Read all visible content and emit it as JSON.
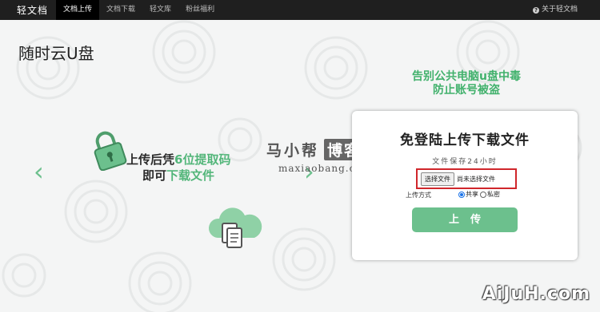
{
  "nav": {
    "brand": "轻文档",
    "items": [
      {
        "label": "文档上传",
        "active": true
      },
      {
        "label": "文档下载",
        "active": false
      },
      {
        "label": "轻文库",
        "active": false
      },
      {
        "label": "粉丝福利",
        "active": false
      }
    ],
    "about": "关于轻文档",
    "about_icon": "info-circle-icon"
  },
  "page": {
    "title": "随时云U盘"
  },
  "slider": {
    "line1_prefix": "上传后凭",
    "line1_highlight": "6位提取码",
    "line2_prefix": "即可",
    "line2_highlight": "下载文件",
    "prev_arrow": "‹",
    "next_arrow": "›",
    "icons": [
      "lock-icon",
      "cloud-document-icon"
    ]
  },
  "warning": {
    "line1": "告别公共电脑u盘中毒",
    "line2": "防止账号被盗"
  },
  "upload": {
    "title": "免登陆上传下载文件",
    "note": "文件保存24小时",
    "file_button": "选择文件",
    "file_status": "尚未选择文件",
    "method_label": "上传方式",
    "options": [
      {
        "label": "共享",
        "checked": true
      },
      {
        "label": "私密",
        "checked": false
      }
    ],
    "submit": "上传"
  },
  "watermarks": {
    "brand": "马小帮",
    "brand_box": "博客",
    "domain": "maxiaobang.com",
    "corner": "AiJuH.com"
  },
  "colors": {
    "accent": "#6cc08d",
    "highlight_text": "#41b16c",
    "navbar": "#1f1f1f",
    "file_box_border": "#d0262b"
  }
}
